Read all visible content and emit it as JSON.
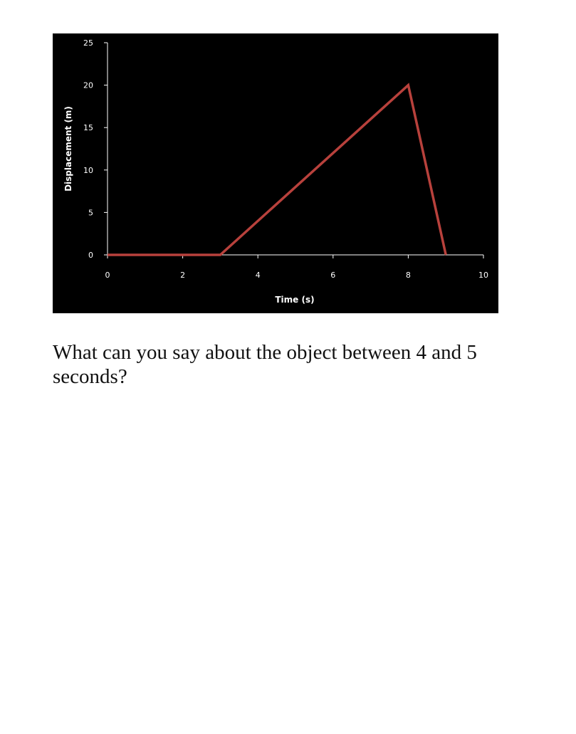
{
  "question": {
    "text": "What can you say about the object between 4 and 5 seconds?"
  },
  "colors": {
    "background": "#000000",
    "line": "#b8413c",
    "axis": "#ffffff",
    "text": "#ffffff"
  },
  "chart_data": {
    "type": "line",
    "title": "",
    "xlabel": "Time (s)",
    "ylabel": "Displacement (m)",
    "xlim": [
      0,
      10
    ],
    "ylim": [
      0,
      25
    ],
    "xticks": [
      0,
      2,
      4,
      6,
      8,
      10
    ],
    "yticks": [
      0,
      5,
      10,
      15,
      20,
      25
    ],
    "grid": false,
    "legend": "none",
    "series": [
      {
        "x": [
          0,
          3,
          8,
          9
        ],
        "y": [
          0,
          0,
          20,
          0
        ]
      }
    ]
  }
}
